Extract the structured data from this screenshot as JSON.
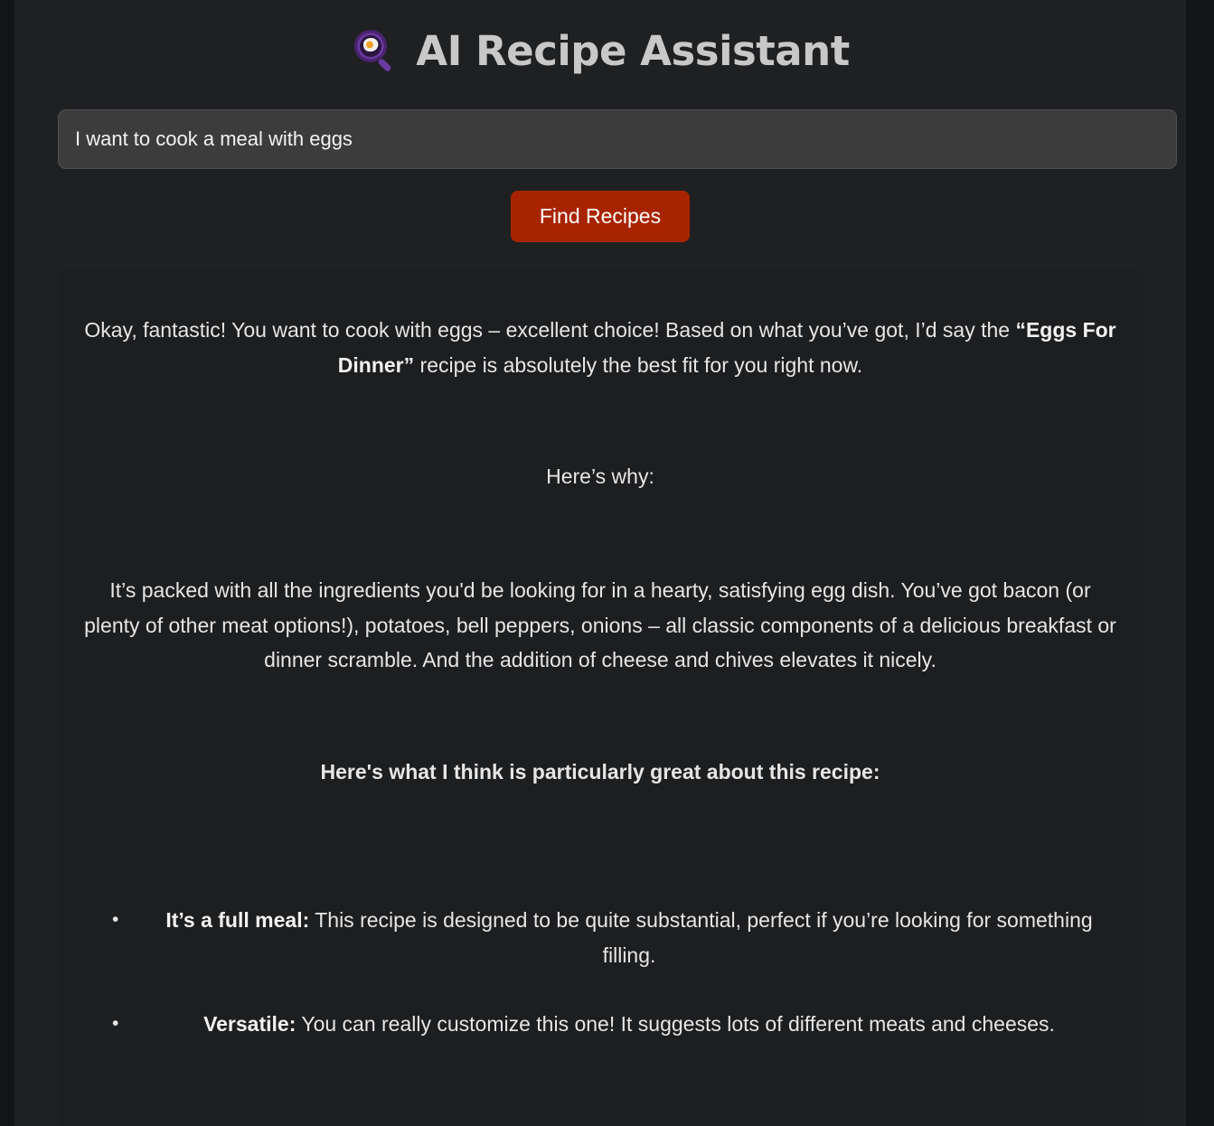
{
  "header": {
    "title": "AI Recipe Assistant",
    "logo_icon": "frying-pan-egg-icon"
  },
  "search": {
    "value": "I want to cook a meal with eggs",
    "placeholder": ""
  },
  "actions": {
    "find_label": "Find Recipes"
  },
  "response": {
    "intro_pre": "Okay, fantastic! You want to cook with eggs – excellent choice! Based on what you’ve got, I’d say the ",
    "intro_bold": "“Eggs For Dinner”",
    "intro_post": " recipe is absolutely the best fit for you right now.",
    "why": "Here’s why:",
    "packed": "It’s packed with all the ingredients you'd be looking for in a hearty, satisfying egg dish. You’ve got bacon (or plenty of other meat options!), potatoes, bell peppers, onions – all classic components of a delicious breakfast or dinner scramble. And the addition of cheese and chives elevates it nicely.",
    "great_heading": "Here's what I think is particularly great about this recipe:",
    "bullets": [
      {
        "label": "It’s a full meal:",
        "text": " This recipe is designed to be quite substantial, perfect if you’re looking for something filling."
      },
      {
        "label": "Versatile:",
        "text": " You can really customize this one!  It suggests lots of different meats and cheeses."
      }
    ]
  },
  "colors": {
    "background": "#1f2022",
    "input": "#3c3c3d",
    "button": "#a82400",
    "text": "#e6e6e6",
    "logo_accent": "#5b2a86"
  }
}
